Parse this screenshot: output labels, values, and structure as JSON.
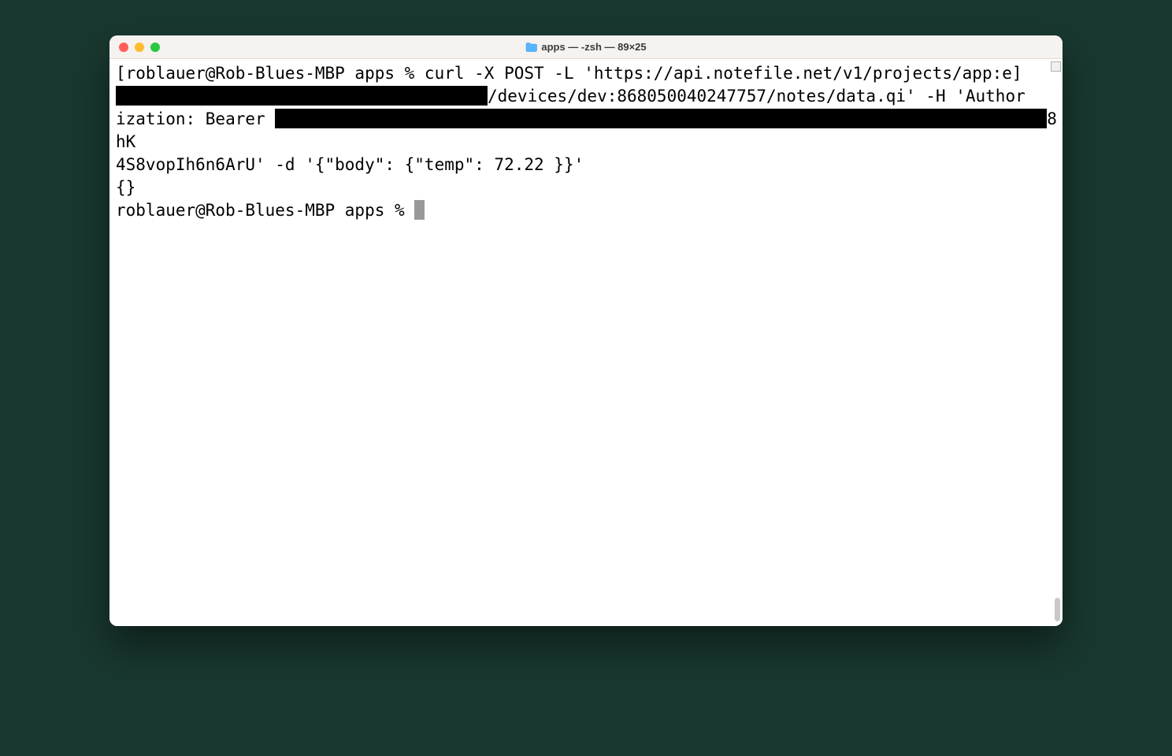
{
  "window": {
    "title": "apps — -zsh — 89×25"
  },
  "terminal": {
    "segments": {
      "s1": "[roblauer@Rob-Blues-MBP apps % curl -X POST -L 'https://api.notefile.net/v1/projects/app:e]",
      "s2": "/devices/dev:868050040247757/notes/data.qi' -H 'Author",
      "s3": "ization: Bearer ",
      "s4": "8hK",
      "s5": "4S8vopIh6n6ArU' -d '{\"body\": {\"temp\": 72.22 }}'",
      "s6": "{}",
      "s7": "roblauer@Rob-Blues-MBP apps % "
    }
  }
}
